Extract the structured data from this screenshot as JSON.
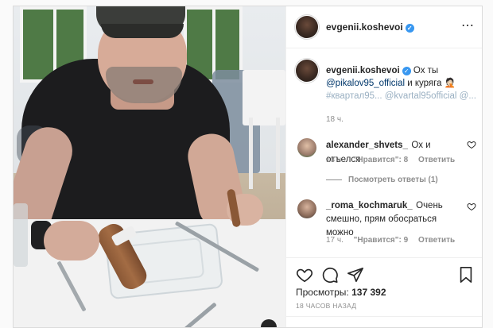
{
  "post": {
    "author": "evgenii.koshevoi",
    "caption": {
      "author": "evgenii.koshevoi",
      "text_lead": "Ох ты",
      "mention": "@pikalov95_official",
      "text_after_mention": "и куряга",
      "emoji": "🤦🏻",
      "faded_tail": "#квартал95... @kvartal95official @..."
    },
    "caption_time": "18 ч.",
    "comments": [
      {
        "user": "alexander_shvets_",
        "text": "Ох и отъелся",
        "time": "18 ч.",
        "likes": "\"Нравится\": 8",
        "reply": "Ответить",
        "view_replies": "Посмотреть ответы (1)"
      },
      {
        "user": "_roma_kochmaruk_",
        "text": "Очень смешно, прям обосраться можно",
        "time": "17 ч.",
        "likes": "\"Нравится\": 9",
        "reply": "Ответить"
      }
    ],
    "views_label": "Просмотры:",
    "views_count": "137 392",
    "posted_ago": "18 ЧАСОВ НАЗАД"
  },
  "icons": {
    "verified": "verified-badge-icon",
    "like": "heart-icon",
    "comment": "comment-bubble-icon",
    "share": "paper-plane-icon",
    "save": "bookmark-icon"
  },
  "colors": {
    "verified": "#3897f0",
    "mention": "#00376b",
    "secondary_text": "#8e8e8e",
    "border": "#dbdbdb"
  }
}
